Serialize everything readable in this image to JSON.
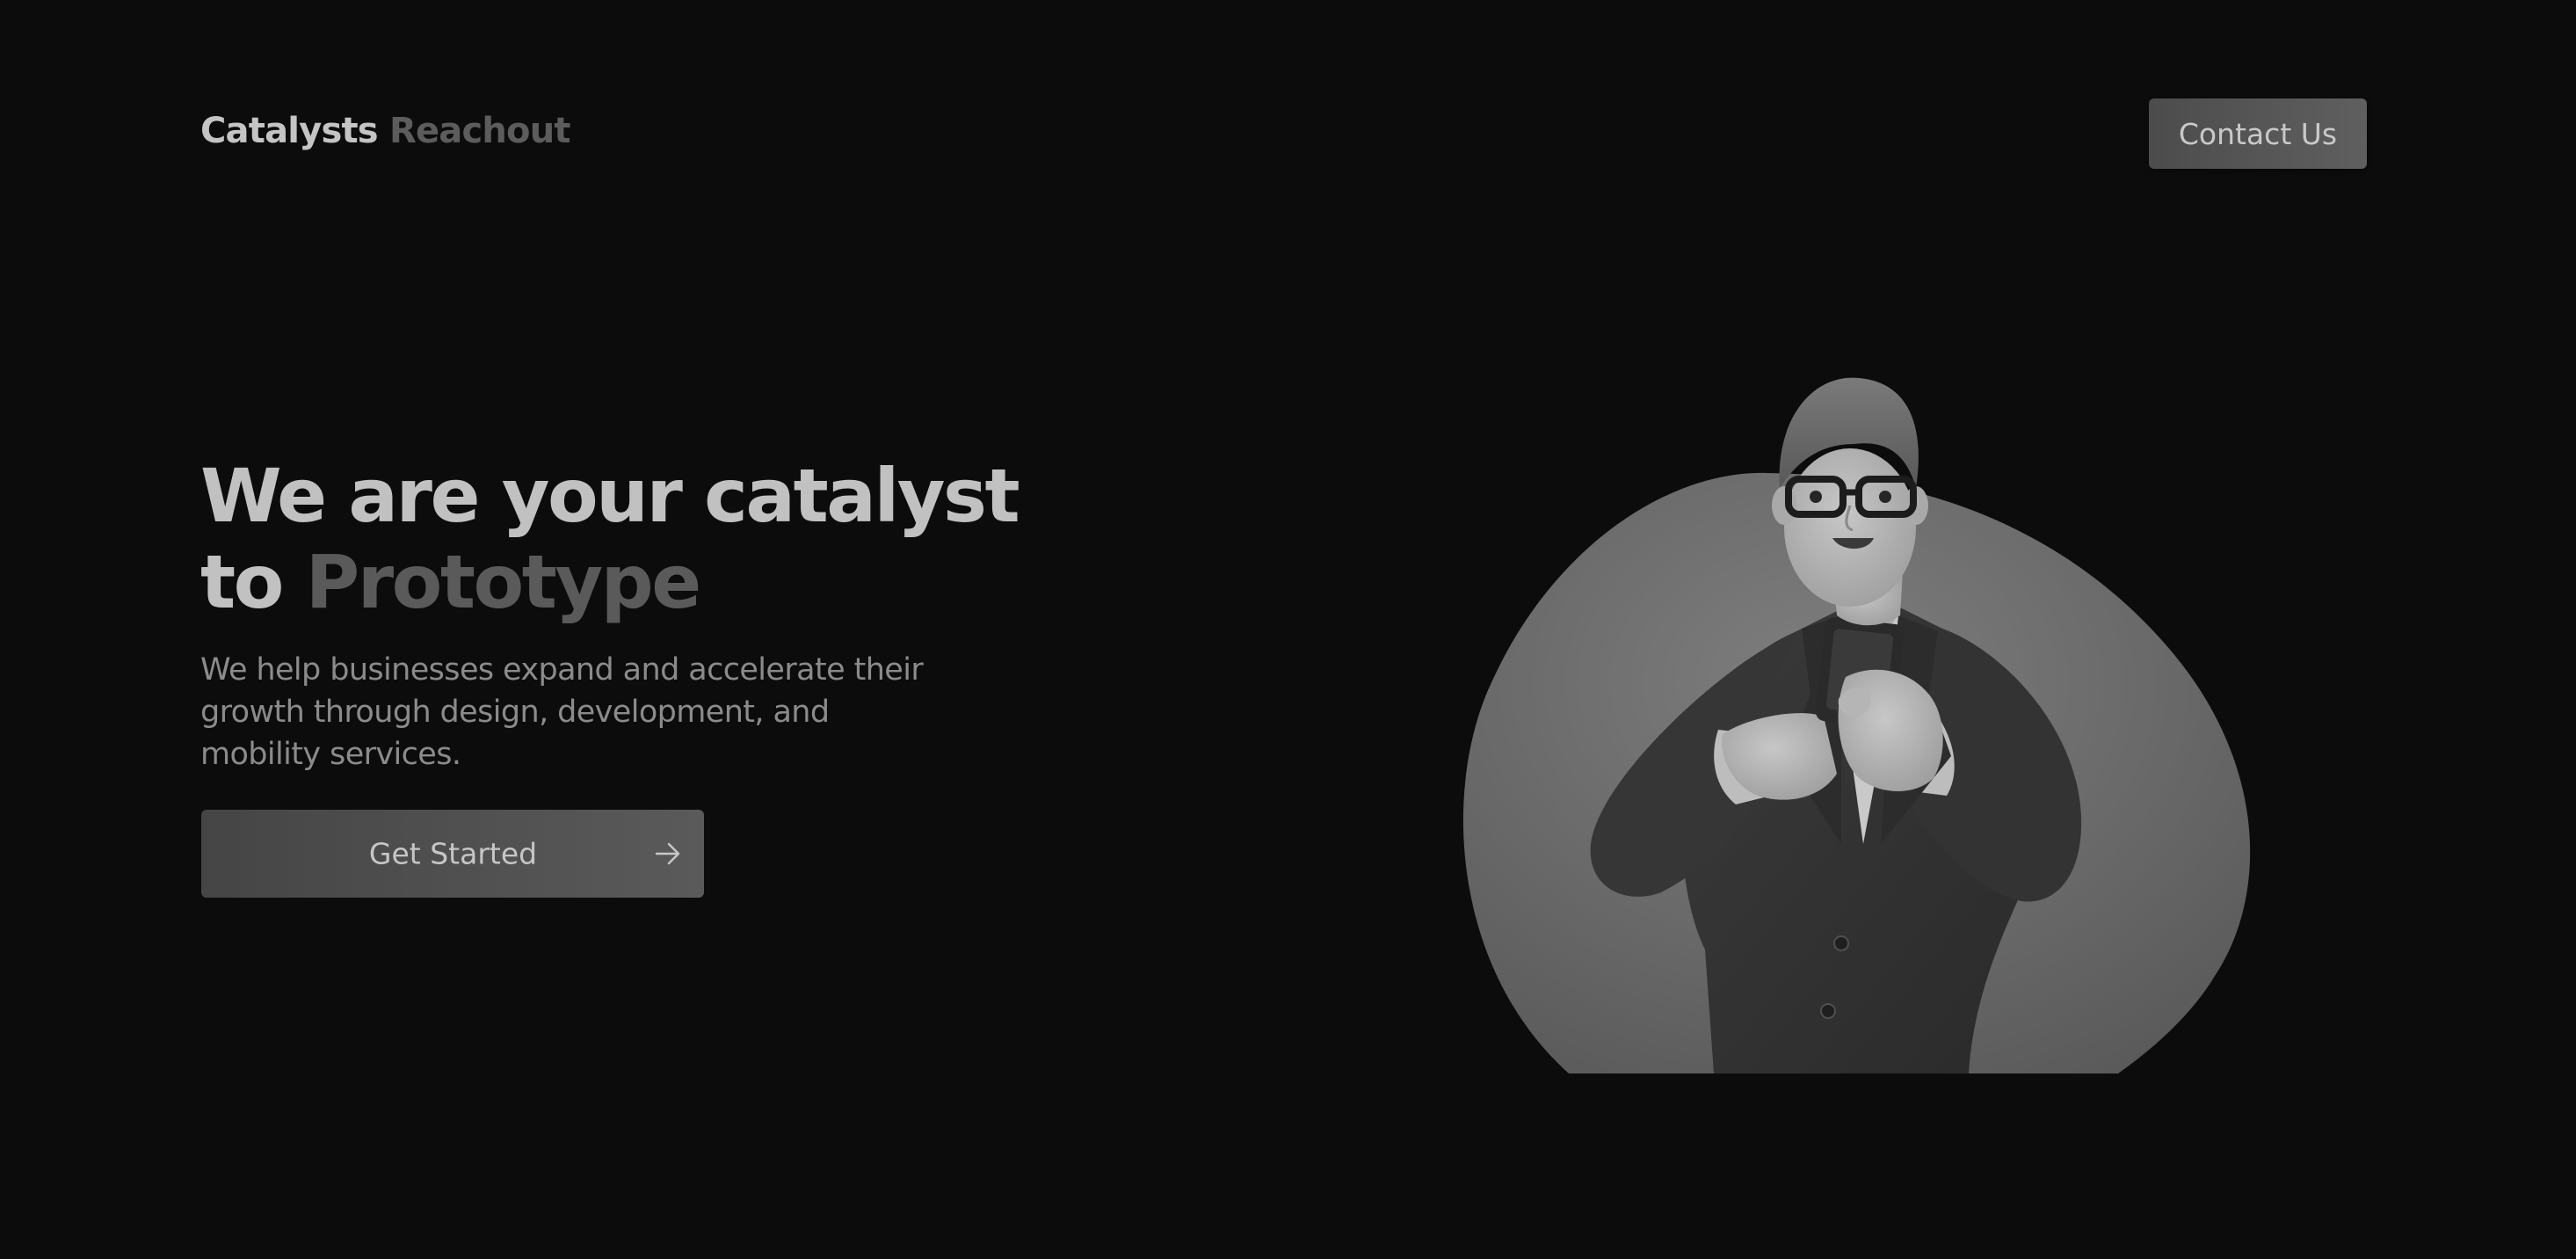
{
  "header": {
    "logo_primary": "Catalysts",
    "logo_secondary": "Reachout",
    "contact_label": "Contact Us"
  },
  "hero": {
    "headline_line1": "We are your catalyst",
    "headline_to": "to",
    "headline_accent": "Prototype",
    "subtitle": "We help businesses expand and accelerate their growth through design, development, and mobility services.",
    "cta_label": "Get Started",
    "cta_icon": "arrow-right-icon",
    "illustration": "businessman-phone-illustration"
  },
  "colors": {
    "background": "#0c0c0c",
    "text_primary": "#c1c1c1",
    "text_muted": "#5a5a5a",
    "button_bg": "#4f4f4f"
  }
}
